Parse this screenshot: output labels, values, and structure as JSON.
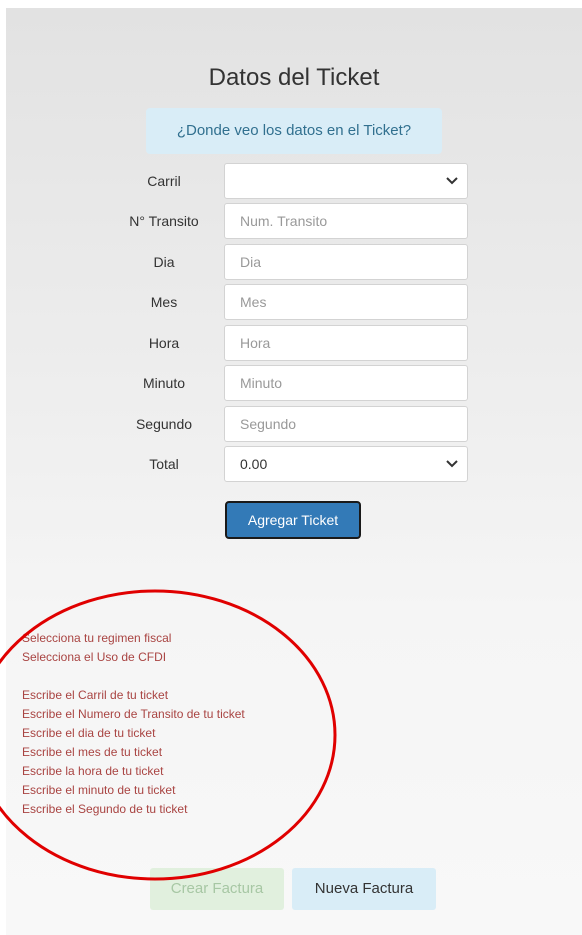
{
  "form": {
    "title": "Datos del Ticket",
    "help_button": "¿Donde veo los datos en el Ticket?",
    "fields": [
      {
        "label": "Carril",
        "type": "select",
        "value": "",
        "placeholder": ""
      },
      {
        "label": "N° Transito",
        "type": "input",
        "value": "",
        "placeholder": "Num. Transito"
      },
      {
        "label": "Dia",
        "type": "input",
        "value": "",
        "placeholder": "Dia"
      },
      {
        "label": "Mes",
        "type": "input",
        "value": "",
        "placeholder": "Mes"
      },
      {
        "label": "Hora",
        "type": "input",
        "value": "",
        "placeholder": "Hora"
      },
      {
        "label": "Minuto",
        "type": "input",
        "value": "",
        "placeholder": "Minuto"
      },
      {
        "label": "Segundo",
        "type": "input",
        "value": "",
        "placeholder": "Segundo"
      },
      {
        "label": "Total",
        "type": "select",
        "value": "0.00",
        "placeholder": ""
      }
    ],
    "add_button": "Agregar Ticket"
  },
  "validation": {
    "messages_group1": [
      "Selecciona tu regimen fiscal",
      "Selecciona el Uso de CFDI"
    ],
    "messages_group2": [
      "Escribe el Carril de tu ticket",
      "Escribe el Numero de Transito de tu ticket",
      "Escribe el dia de tu ticket",
      "Escribe el mes de tu ticket",
      "Escribe la hora de tu ticket",
      "Escribe el minuto de tu ticket",
      "Escribe el Segundo de tu ticket"
    ]
  },
  "footer": {
    "crear_button": "Crear Factura",
    "nueva_button": "Nueva Factura"
  },
  "colors": {
    "annotation_circle": "#e00000",
    "error_text": "#a94442",
    "primary": "#337ab7",
    "info_bg": "#d9edf7",
    "success_disabled_bg": "#e1f0de"
  },
  "icons": {
    "select_arrow": "chevron-down-icon"
  }
}
